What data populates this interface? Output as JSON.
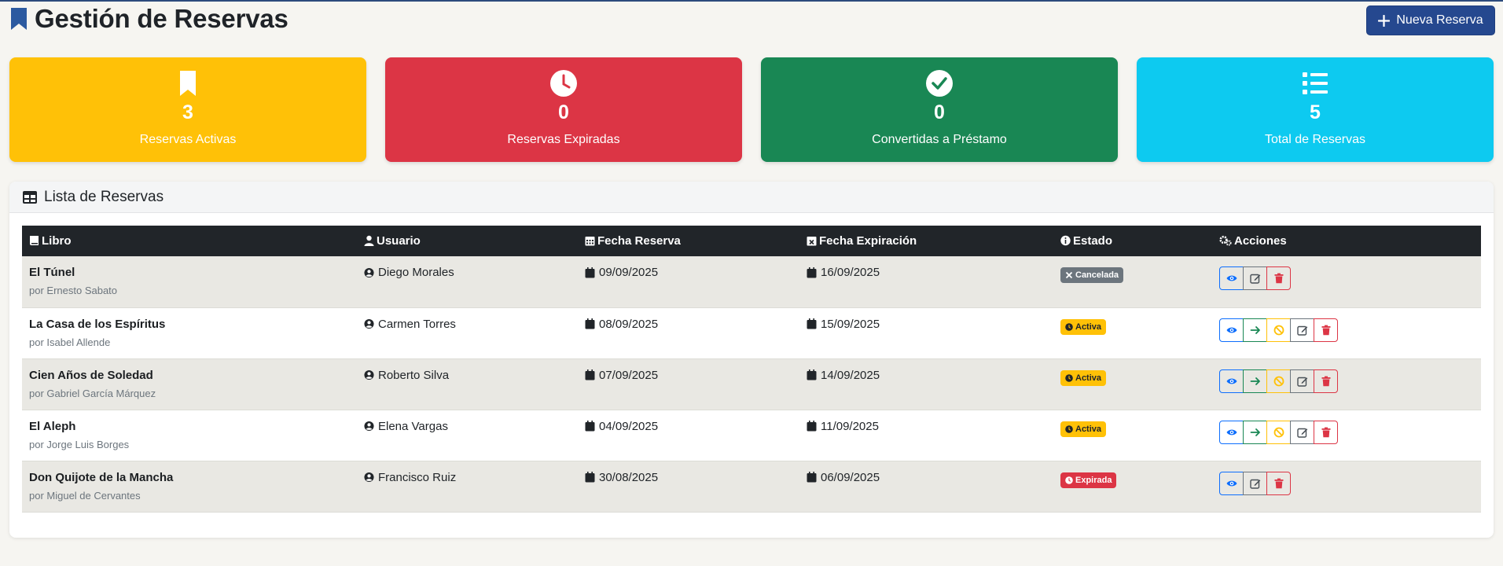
{
  "header": {
    "title": "Gestión de Reservas",
    "new_button_label": "Nueva Reserva"
  },
  "stats": [
    {
      "value": "3",
      "label": "Reservas Activas",
      "icon": "bookmark-icon",
      "color": "#ffc107"
    },
    {
      "value": "0",
      "label": "Reservas Expiradas",
      "icon": "clock-icon",
      "color": "#dc3545"
    },
    {
      "value": "0",
      "label": "Convertidas a Préstamo",
      "icon": "check-circle-icon",
      "color": "#198754"
    },
    {
      "value": "5",
      "label": "Total de Reservas",
      "icon": "list-icon",
      "color": "#0dcaf0"
    }
  ],
  "panel": {
    "title": "Lista de Reservas"
  },
  "table": {
    "columns": [
      "Libro",
      "Usuario",
      "Fecha Reserva",
      "Fecha Expiración",
      "Estado",
      "Acciones"
    ],
    "rows": [
      {
        "title": "El Túnel",
        "author": "por Ernesto Sabato",
        "user": "Diego Morales",
        "reserved": "09/09/2025",
        "expires": "16/09/2025",
        "status": "Cancelada",
        "status_kind": "cancelada",
        "actions": [
          "view",
          "edit",
          "delete"
        ]
      },
      {
        "title": "La Casa de los Espíritus",
        "author": "por Isabel Allende",
        "user": "Carmen Torres",
        "reserved": "08/09/2025",
        "expires": "15/09/2025",
        "status": "Activa",
        "status_kind": "activa",
        "actions": [
          "view",
          "convert",
          "cancel",
          "edit",
          "delete"
        ]
      },
      {
        "title": "Cien Años de Soledad",
        "author": "por Gabriel García Márquez",
        "user": "Roberto Silva",
        "reserved": "07/09/2025",
        "expires": "14/09/2025",
        "status": "Activa",
        "status_kind": "activa",
        "actions": [
          "view",
          "convert",
          "cancel",
          "edit",
          "delete"
        ]
      },
      {
        "title": "El Aleph",
        "author": "por Jorge Luis Borges",
        "user": "Elena Vargas",
        "reserved": "04/09/2025",
        "expires": "11/09/2025",
        "status": "Activa",
        "status_kind": "activa",
        "actions": [
          "view",
          "convert",
          "cancel",
          "edit",
          "delete"
        ]
      },
      {
        "title": "Don Quijote de la Mancha",
        "author": "por Miguel de Cervantes",
        "user": "Francisco Ruiz",
        "reserved": "30/08/2025",
        "expires": "06/09/2025",
        "status": "Expirada",
        "status_kind": "expirada",
        "actions": [
          "view",
          "edit",
          "delete"
        ]
      }
    ]
  }
}
